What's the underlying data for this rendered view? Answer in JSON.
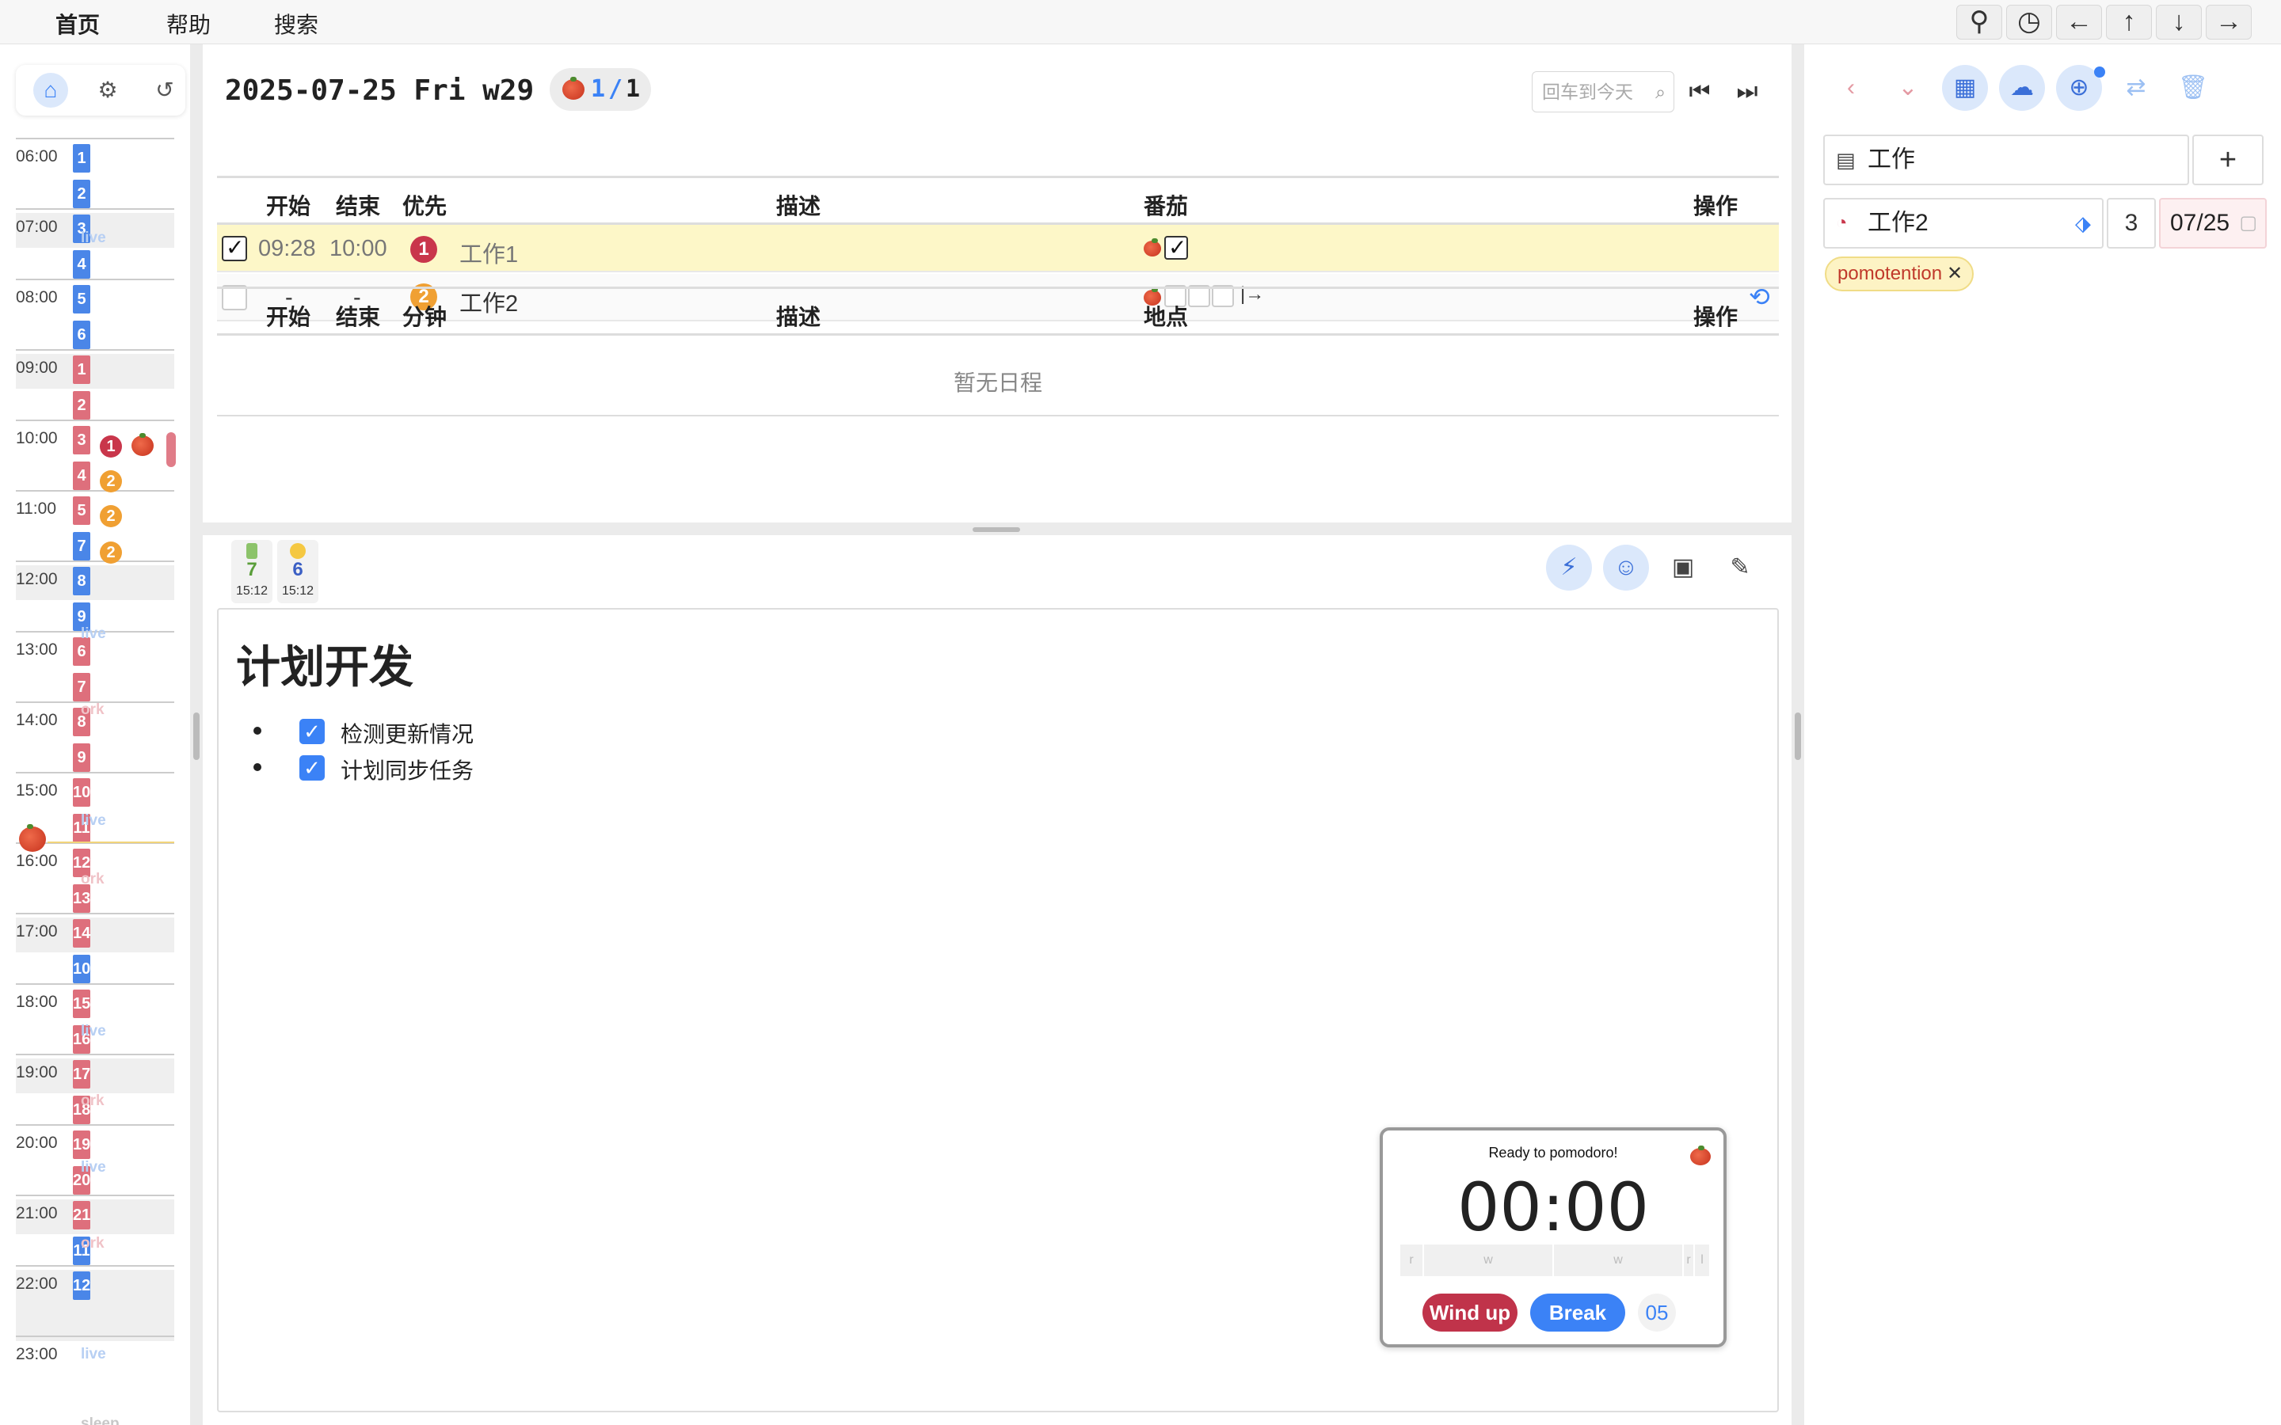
{
  "menu": {
    "items": [
      "首页",
      "帮助",
      "搜索"
    ],
    "window_buttons": [
      "pin-icon",
      "timer-icon",
      "arrow-left-icon",
      "arrow-up-icon",
      "arrow-down-icon",
      "arrow-right-icon"
    ]
  },
  "left_panel": {
    "toolbar": [
      "backpack-icon",
      "gear-icon",
      "undo-icon"
    ],
    "hours": [
      "06:00",
      "07:00",
      "08:00",
      "09:00",
      "10:00",
      "11:00",
      "12:00",
      "13:00",
      "14:00",
      "15:00",
      "16:00",
      "17:00",
      "18:00",
      "19:00",
      "20:00",
      "21:00",
      "22:00",
      "23:00"
    ],
    "slots": [
      {
        "n": "1",
        "c": "blue"
      },
      {
        "n": "2",
        "c": "blue"
      },
      {
        "n": "3",
        "c": "blue"
      },
      {
        "n": "4",
        "c": "blue"
      },
      {
        "n": "5",
        "c": "blue"
      },
      {
        "n": "6",
        "c": "blue"
      },
      {
        "n": "1",
        "c": "red"
      },
      {
        "n": "2",
        "c": "red"
      },
      {
        "n": "3",
        "c": "red"
      },
      {
        "n": "4",
        "c": "red"
      },
      {
        "n": "5",
        "c": "red"
      },
      {
        "n": "7",
        "c": "blue"
      },
      {
        "n": "8",
        "c": "blue"
      },
      {
        "n": "9",
        "c": "blue"
      },
      {
        "n": "6",
        "c": "red"
      },
      {
        "n": "7",
        "c": "red"
      },
      {
        "n": "8",
        "c": "red"
      },
      {
        "n": "9",
        "c": "red"
      },
      {
        "n": "10",
        "c": "red"
      },
      {
        "n": "11",
        "c": "red"
      },
      {
        "n": "12",
        "c": "red"
      },
      {
        "n": "13",
        "c": "red"
      },
      {
        "n": "14",
        "c": "red"
      },
      {
        "n": "10",
        "c": "blue"
      },
      {
        "n": "15",
        "c": "red"
      },
      {
        "n": "16",
        "c": "red"
      },
      {
        "n": "17",
        "c": "red"
      },
      {
        "n": "18",
        "c": "red"
      },
      {
        "n": "19",
        "c": "red"
      },
      {
        "n": "20",
        "c": "red"
      },
      {
        "n": "21",
        "c": "red"
      },
      {
        "n": "11",
        "c": "blue"
      },
      {
        "n": "12",
        "c": "blue"
      }
    ],
    "tags": [
      {
        "t": "live",
        "c": "blue"
      },
      {
        "t": "live",
        "c": "blue"
      },
      {
        "t": "ork",
        "c": "red"
      },
      {
        "t": "live",
        "c": "blue"
      },
      {
        "t": "ork",
        "c": "red"
      },
      {
        "t": "live",
        "c": "blue"
      },
      {
        "t": "ork",
        "c": "red"
      },
      {
        "t": "live",
        "c": "blue"
      },
      {
        "t": "ork",
        "c": "red"
      },
      {
        "t": "live",
        "c": "blue"
      },
      {
        "t": "sleep",
        "c": "gray"
      }
    ],
    "prio_marks": [
      "1",
      "2",
      "2",
      "2"
    ]
  },
  "center": {
    "date_title": "2025-07-25 Fri w29",
    "pomo_done": "1",
    "pomo_sep": "/",
    "pomo_total": "1",
    "search_placeholder": "回车到今天",
    "tasks_header": {
      "start": "开始",
      "end": "结束",
      "priority": "优先",
      "desc": "描述",
      "pomodoro": "番茄",
      "ops": "操作"
    },
    "tasks": [
      {
        "start": "09:28",
        "end": "10:00",
        "priority": "1",
        "name": "工作1",
        "checked": true
      },
      {
        "start": "-",
        "end": "-",
        "priority": "2",
        "name": "工作2",
        "checked": false
      }
    ],
    "schedule_header": {
      "start": "开始",
      "end": "结束",
      "minutes": "分钟",
      "desc": "描述",
      "location": "地点",
      "ops": "操作"
    },
    "schedule_empty": "暂无日程",
    "mini_cards": [
      {
        "num": "7",
        "time": "15:12",
        "color": "#5a9e3a"
      },
      {
        "num": "6",
        "time": "15:12",
        "color": "#3b5fc4"
      }
    ],
    "editor": {
      "title": "计划开发",
      "todos": [
        "检测更新情况",
        "计划同步任务"
      ]
    },
    "pomodoro": {
      "status": "Ready to pomodoro!",
      "time": "00:00",
      "segments": [
        "r",
        "w",
        "w",
        "r",
        "l"
      ],
      "wind_up": "Wind up",
      "break": "Break",
      "count": "05",
      "wind_color": "#c0334a",
      "break_color": "#3b82f6"
    }
  },
  "right_panel": {
    "project": "工作",
    "add_label": "+",
    "task_name": "工作2",
    "task_count": "3",
    "task_date": "07/25",
    "tag": "pomotention"
  }
}
